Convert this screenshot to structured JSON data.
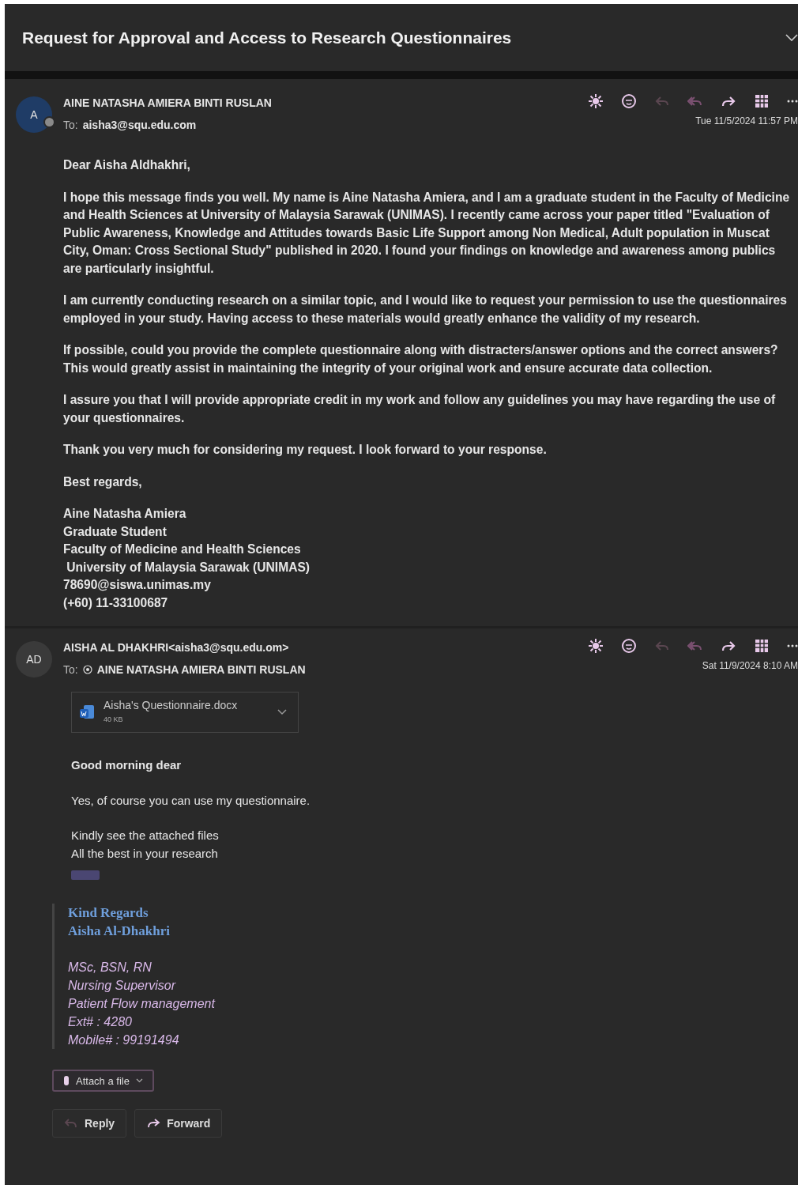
{
  "title": "Request for Approval and Access to Research Questionnaires",
  "messages": [
    {
      "avatar": "A",
      "color": "#1f3c66",
      "presence": true,
      "sender": "AINE NATASHA AMIERA BINTI RUSLAN",
      "to_label": "To:",
      "recipient": "aisha3@squ.edu.com",
      "recipient_icon": false,
      "date": "Tue 11/5/2024 11:57 PM",
      "blocks": [
        {
          "kind": "paragraph",
          "text": "Dear Aisha Aldhakhri,"
        },
        {
          "kind": "paragraph",
          "text": "I hope this message finds you well. My name is Aine Natasha Amiera, and I am a graduate student in the Faculty of Medicine and Health Sciences at University of Malaysia Sarawak (UNIMAS). I recently came across your paper titled \"Evaluation of Public Awareness, Knowledge and Attitudes towards Basic Life Support among Non Medical, Adult population in Muscat City, Oman: Cross Sectional Study\" published in 2020. I found your findings on knowledge and awareness among publics are particularly insightful."
        },
        {
          "kind": "paragraph",
          "text": "I am currently conducting research on a similar topic, and I would like to request your permission to use the questionnaires employed in your study. Having access to these materials would greatly enhance the validity of my research."
        },
        {
          "kind": "paragraph",
          "text": "If possible, could you provide the complete questionnaire along with distracters/answer options and the correct answers? This would greatly assist in maintaining the integrity of your original work and ensure accurate data collection."
        },
        {
          "kind": "paragraph",
          "text": "I assure you that I will provide appropriate credit in my work and follow any guidelines you may have regarding the use of your questionnaires."
        },
        {
          "kind": "paragraph",
          "text": "Thank you very much for considering my request. I look forward to your response."
        },
        {
          "kind": "paragraph",
          "text": "Best regards,"
        },
        {
          "kind": "lines",
          "lines": [
            "Aine Natasha Amiera",
            "Graduate Student",
            "Faculty of Medicine and Health Sciences",
            " University of Malaysia Sarawak (UNIMAS)",
            "78690@siswa.unimas.my",
            "(+60) 11-33100687"
          ]
        }
      ]
    },
    {
      "avatar": "AD",
      "color": "#3a3a3a",
      "presence": false,
      "sender": "AISHA AL DHAKHRI<aisha3@squ.edu.om>",
      "to_label": "To:",
      "recipient": "AINE NATASHA AMIERA BINTI RUSLAN",
      "recipient_icon": true,
      "date": "Sat 11/9/2024 8:10 AM",
      "attachment": {
        "name": "Aisha's Questionnaire.docx",
        "size": "40 KB"
      },
      "blocks": [
        {
          "kind": "bold",
          "text": "Good morning dear"
        },
        {
          "kind": "paragraph",
          "text": "Yes, of course you can use my questionnaire."
        },
        {
          "kind": "lines",
          "lines": [
            "Kindly see the attached files",
            "All the best in your research"
          ]
        },
        {
          "kind": "chip"
        },
        {
          "kind": "signature",
          "greeting": [
            "Kind Regards",
            "Aisha Al-Dhakhri"
          ],
          "details": [
            "MSc, BSN, RN",
            "Nursing Supervisor",
            "Patient Flow management",
            "Ext# :  4280",
            "Mobile# :  99191494"
          ]
        }
      ]
    }
  ],
  "attach_button": "Attach a file",
  "actions": [
    {
      "kind": "reply",
      "label": "Reply"
    },
    {
      "kind": "forward",
      "label": "Forward"
    }
  ]
}
